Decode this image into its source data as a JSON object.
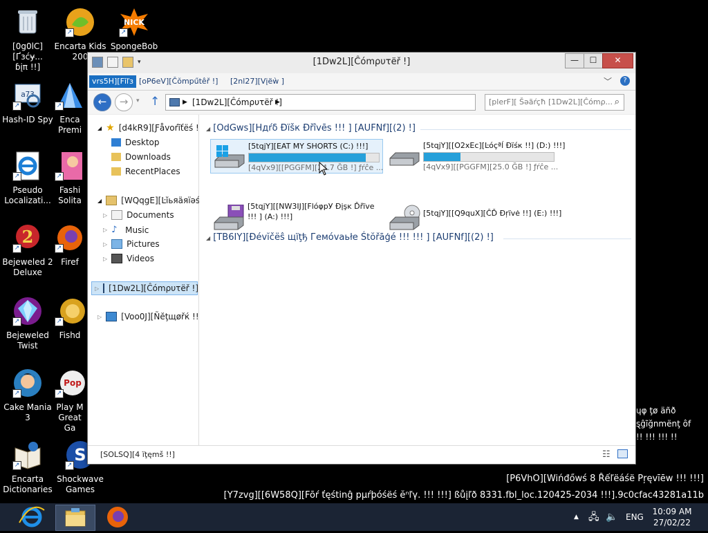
{
  "desktop": {
    "icons": [
      {
        "label": "[0g0lC][Ґзćɏ...\nɓįπ !!]",
        "icon": "recycle-bin-icon"
      },
      {
        "label": "Encarta Kids\n200",
        "icon": "encarta-kids-icon"
      },
      {
        "label": "SpongeBob",
        "icon": "spongebob-icon"
      },
      {
        "label": "Hash-ID Spy",
        "icon": "hash-id-spy-icon"
      },
      {
        "label": "Enca\nPremi",
        "icon": "encarta-premium-icon"
      },
      {
        "label": "Pseudo\nLocalizati...",
        "icon": "internet-explorer-icon"
      },
      {
        "label": "Fashi\nSolita",
        "icon": "fashion-solitaire-icon"
      },
      {
        "label": "Bejeweled 2\nDeluxe",
        "icon": "bejeweled-2-icon"
      },
      {
        "label": "Firef",
        "icon": "firefox-icon"
      },
      {
        "label": "Bejeweled\nTwist",
        "icon": "bejeweled-twist-icon"
      },
      {
        "label": "Fishd",
        "icon": "fishdom-icon"
      },
      {
        "label": "Cake Mania 3",
        "icon": "cake-mania-icon"
      },
      {
        "label": "Play M\nGreat Ga",
        "icon": "play-more-games-icon"
      },
      {
        "label": "Encarta\nDictionaries",
        "icon": "encarta-dictionaries-icon"
      },
      {
        "label": "Shockwave\nGames",
        "icon": "shockwave-games-icon"
      }
    ],
    "right_overflow_text": [
      "ɥφ ţø äñð",
      "ȿĝĩğnmënţ ôf",
      "!! !!! !!! !!"
    ],
    "watermark": {
      "line1": "[P6VhO][Wińđőwś 8 Ȓếľëáśë Pŗęvīēw !!! !!!]",
      "line2": "[Y7zvg][[6W58Q][Fōŕ ťęśtinĝ pµŕþóśëś ĕⁿľγ. !!! !!!] ßůįľð 8331.fbl_loc.120425-2034 !!!].9c0cfac43281a11b"
    }
  },
  "window": {
    "title": "[1Dw2L][Ĉómρυτëř !]",
    "controls": {
      "minimize": "—",
      "maximize": "☐",
      "close": "✕"
    },
    "ribbon_tabs": {
      "file": "vrs5H][Fīľз",
      "computer": "[oP6eV][Čŏmpűtêř !]",
      "view": "[2nl27][Vįëẁ ]"
    },
    "address": "[1Dw2L][Ĉómρυτëř !]",
    "search_placeholder": "[plerF][ Šəãŕçħ [1Dw2L][Ĉómρ...",
    "nav": {
      "favorites": "[d4kR9][Ƒåvοŕĩťëś !!]",
      "desktop": "Desktop",
      "downloads": "Downloads",
      "recent": "RecentPlaces",
      "libraries": "[WQqgE][Ŀĭьяäяïəś !!]",
      "documents": "Documents",
      "music": "Music",
      "pictures": "Pictures",
      "videos": "Videos",
      "computer": "[1Dw2L][Ĉómρυτëř !]",
      "network": "[Voo0J][Ñĕţщøřќ !!]"
    },
    "groups": {
      "hard_disks": "[OdGws][Hдŕδ Ðïšк Ðřîvēѕ !!! ] [AUFNf][(2) !]",
      "removable": "[TB6IY][Ðévĭčёŝ щïţђ Гемóvaьłe Śtŏřāģé !!! !!! ] [AUFNf][(2) !]"
    },
    "drives": [
      {
        "name": "[5tqjY][EAT MY SHORTS (C:) !!!]",
        "free": "[4qVx9][[PGGFM][24.7 ĞB !] ƒŕĉe ...",
        "used_fraction": 0.9,
        "icon": "windows-drive-icon"
      },
      {
        "name": "[5tqjY][[O2xEc][Ŀóçªĺ Ðïśк !!] (D:) !!!]",
        "free": "[4qVx9][[PGGFM][25.0 ĞB !] ƒŕĉe ...",
        "used_fraction": 0.28,
        "icon": "hard-drive-icon"
      },
      {
        "name": "[5tqjY][[NW3IJ][FlóφрУ Ðįşĸ Ďřïve\n!!! ] (A:) !!!]",
        "icon": "floppy-drive-icon"
      },
      {
        "name": "[5tqjY][[Q9quX][ĈĎ Ðŗïvė !!] (E:) !!!]",
        "icon": "cd-drive-icon"
      }
    ],
    "tooltip": "",
    "status": "[SOLSQ][4 ïţęmš !!]"
  },
  "taskbar": {
    "language": "ENG",
    "time": "10:09 AM",
    "date": "27/02/22"
  }
}
